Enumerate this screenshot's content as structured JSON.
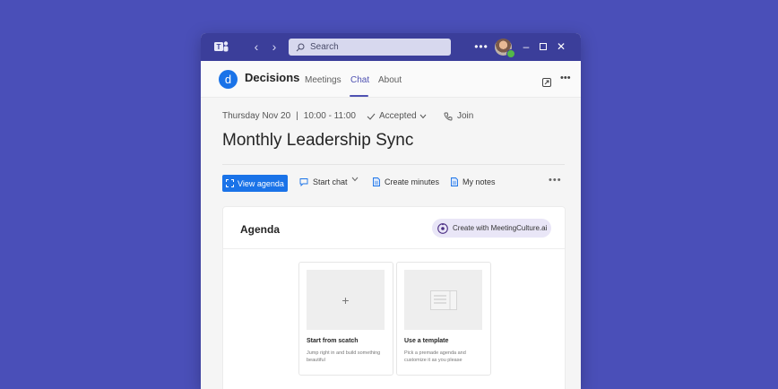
{
  "titlebar": {
    "search_placeholder": "Search"
  },
  "app": {
    "name": "Decisions",
    "icon_letter": "d",
    "tabs": [
      {
        "label": "Meetings",
        "active": false
      },
      {
        "label": "Chat",
        "active": true
      },
      {
        "label": "About",
        "active": false
      }
    ]
  },
  "meeting": {
    "date": "Thursday Nov 20",
    "separator": "|",
    "time": "10:00 - 11:00",
    "rsvp": "Accepted",
    "join_label": "Join",
    "title": "Monthly Leadership Sync"
  },
  "toolbar": {
    "view_agenda": "View agenda",
    "start_chat": "Start chat",
    "create_minutes": "Create minutes",
    "my_notes": "My notes"
  },
  "agenda": {
    "title": "Agenda",
    "ai_button": "Create with MeetingCulture.ai",
    "options": [
      {
        "title": "Start from scatch",
        "description": "Jump right in and build something beautiful"
      },
      {
        "title": "Use a template",
        "description": "Pick a premade agenda and customize it as you please"
      }
    ]
  },
  "colors": {
    "background": "#4a4fb8",
    "titlebar": "#3b3e9a",
    "accent": "#4f52b2",
    "primary_button": "#1a73e8",
    "presence": "#53b848"
  }
}
